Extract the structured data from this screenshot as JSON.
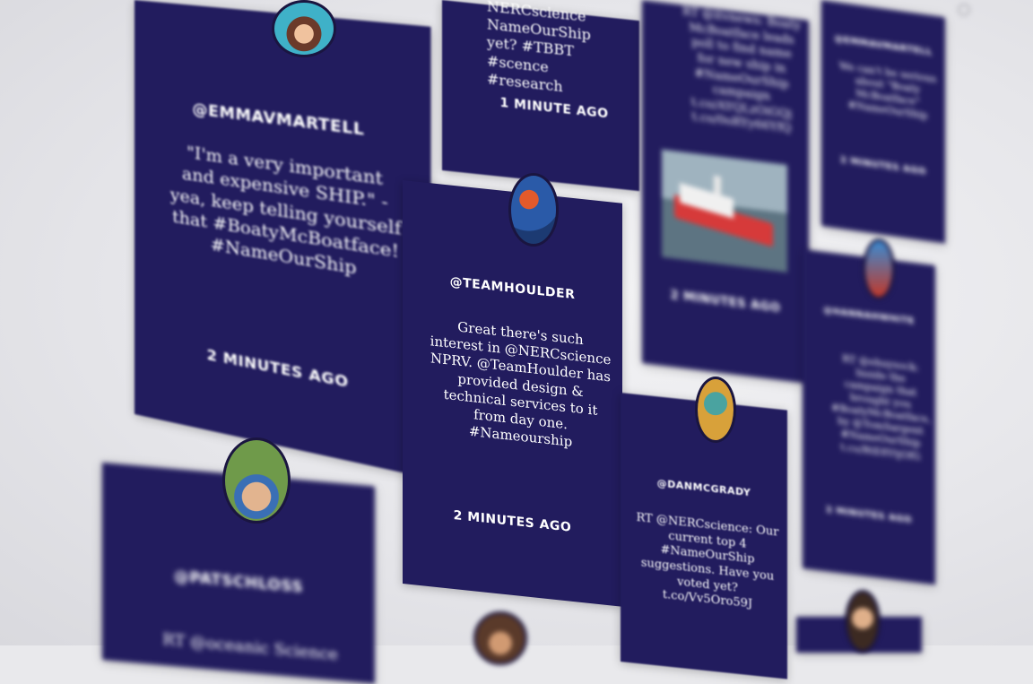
{
  "cards": [
    {
      "handle": "@EMMAVMARTELL",
      "text": "\"I'm a very important and expensive SHIP.\" - yea, keep telling yourself that #BoatyMcBoatface! #NameOurShip",
      "time": "2 MINUTES AGO",
      "avatar": "woman-avatar-icon"
    },
    {
      "handle": "",
      "text": "NameOurShip yet? #TBBT #scence #research",
      "text_top": "NERCscience",
      "time": "1 MINUTE AGO"
    },
    {
      "handle": "",
      "text": "RT @itvnews: Boaty McBoatface leads poll to find name for new ship in #NameOurShip campaign t.co/AYQLzOiGQj t.co/0oRYy66YfQ",
      "time": "2 MINUTES AGO",
      "image": "red-ship-photo"
    },
    {
      "handle": "@EMMAVMARTELL",
      "text": "We can't be serious about \"Boaty McBoatface\" #NameOurShip",
      "time": "2 MINUTES AGO"
    },
    {
      "handle": "@TEAMHOULDER",
      "text": "Great there's such interest in @NERCscience NPRV. @TeamHoulder has provided design & technical services to it from day one. #Nameourship",
      "time": "2 MINUTES AGO",
      "avatar": "ship-avatar-icon"
    },
    {
      "handle": "@HANNAHWHITE",
      "text": "RT @ehuysock: Inside the campaign that brought you #BoatyMcBoatface, by @TomSargent #NameOurShip t.co/RtE8YtjOfG",
      "time": "2 MINUTES AGO",
      "avatar": "person-avatar-icon"
    },
    {
      "handle": "@DANMCGRADY",
      "text": "RT @NERCscience: Our current top 4 #NameOurShip suggestions. Have you voted yet? t.co/Vv5Oro59J",
      "time": "",
      "avatar": "statue-avatar-icon"
    },
    {
      "handle": "@PATSCHLOSS",
      "text": "RT @oceanic Science",
      "time": "",
      "avatar": "child-avatar-icon"
    }
  ]
}
